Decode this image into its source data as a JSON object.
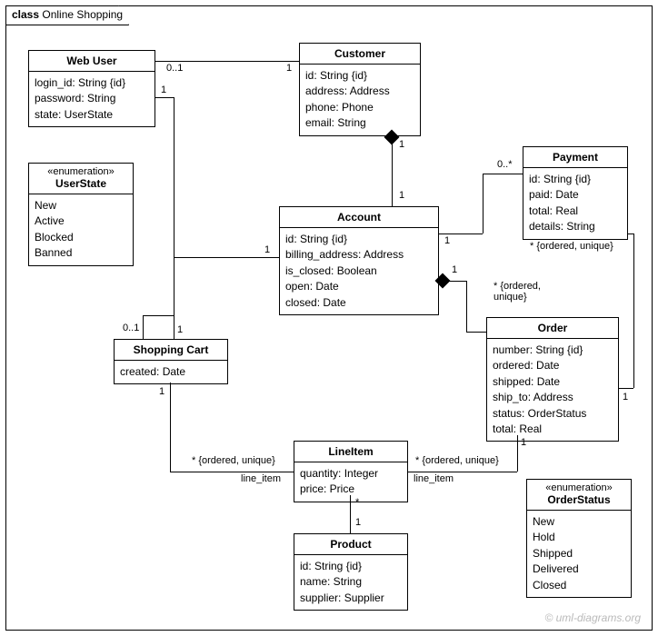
{
  "frame_title_prefix": "class",
  "frame_title": "Online Shopping",
  "classes": {
    "webuser": {
      "name": "Web User",
      "attrs": [
        "login_id: String {id}",
        "password: String",
        "state: UserState"
      ]
    },
    "customer": {
      "name": "Customer",
      "attrs": [
        "id: String {id}",
        "address: Address",
        "phone: Phone",
        "email: String"
      ]
    },
    "payment": {
      "name": "Payment",
      "attrs": [
        "id: String {id}",
        "paid: Date",
        "total: Real",
        "details: String"
      ]
    },
    "account": {
      "name": "Account",
      "attrs": [
        "id: String {id}",
        "billing_address: Address",
        "is_closed: Boolean",
        "open: Date",
        "closed: Date"
      ]
    },
    "order": {
      "name": "Order",
      "attrs": [
        "number: String {id}",
        "ordered: Date",
        "shipped: Date",
        "ship_to: Address",
        "status: OrderStatus",
        "total: Real"
      ]
    },
    "shoppingcart": {
      "name": "Shopping Cart",
      "attrs": [
        "created: Date"
      ]
    },
    "lineitem": {
      "name": "LineItem",
      "attrs": [
        "quantity: Integer",
        "price: Price"
      ]
    },
    "product": {
      "name": "Product",
      "attrs": [
        "id: String {id}",
        "name: String",
        "supplier: Supplier"
      ]
    },
    "userstate": {
      "stereotype": "«enumeration»",
      "name": "UserState",
      "attrs": [
        "New",
        "Active",
        "Blocked",
        "Banned"
      ]
    },
    "orderstatus": {
      "stereotype": "«enumeration»",
      "name": "OrderStatus",
      "attrs": [
        "New",
        "Hold",
        "Shipped",
        "Delivered",
        "Closed"
      ]
    }
  },
  "labels": {
    "m_0_1_a": "0..1",
    "m_1_a": "1",
    "m_1_b": "1",
    "m_1_c": "1",
    "m_1_d": "1",
    "m_1_e": "1",
    "m_1_f": "1",
    "m_1_g": "1",
    "m_1_h": "1",
    "m_1_i": "1",
    "m_1_j": "1",
    "m_1_k": "1",
    "m_0_star": "0..*",
    "m_0_1_b": "0..1",
    "m_star_a": "*",
    "ord_uni_a": "* {ordered, unique}",
    "ord_uni_b": "* {ordered,\nunique}",
    "ord_uni_c": "* {ordered, unique}",
    "ord_uni_d": "* {ordered, unique}",
    "line_item_a": "line_item",
    "line_item_b": "line_item"
  },
  "watermark": "© uml-diagrams.org"
}
